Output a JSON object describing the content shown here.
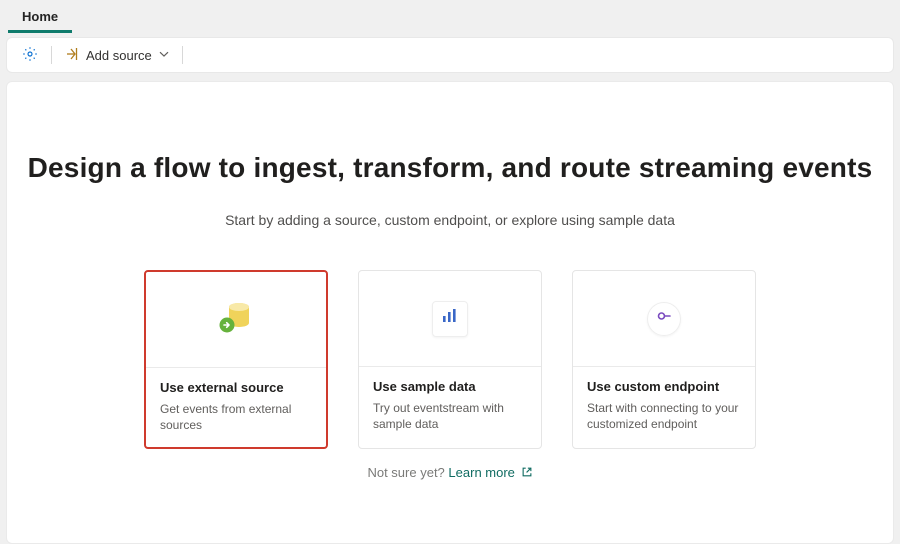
{
  "tabs": {
    "home": "Home"
  },
  "toolbar": {
    "add_source_label": "Add source"
  },
  "hero": {
    "title": "Design a flow to ingest, transform, and route streaming events",
    "subtitle": "Start by adding a source, custom endpoint, or explore using sample data"
  },
  "cards": [
    {
      "title": "Use external source",
      "desc": "Get events from external sources"
    },
    {
      "title": "Use sample data",
      "desc": "Try out eventstream with sample data"
    },
    {
      "title": "Use custom endpoint",
      "desc": "Start with connecting to your customized endpoint"
    }
  ],
  "footer": {
    "not_sure": "Not sure yet?",
    "learn_more": "Learn more"
  }
}
